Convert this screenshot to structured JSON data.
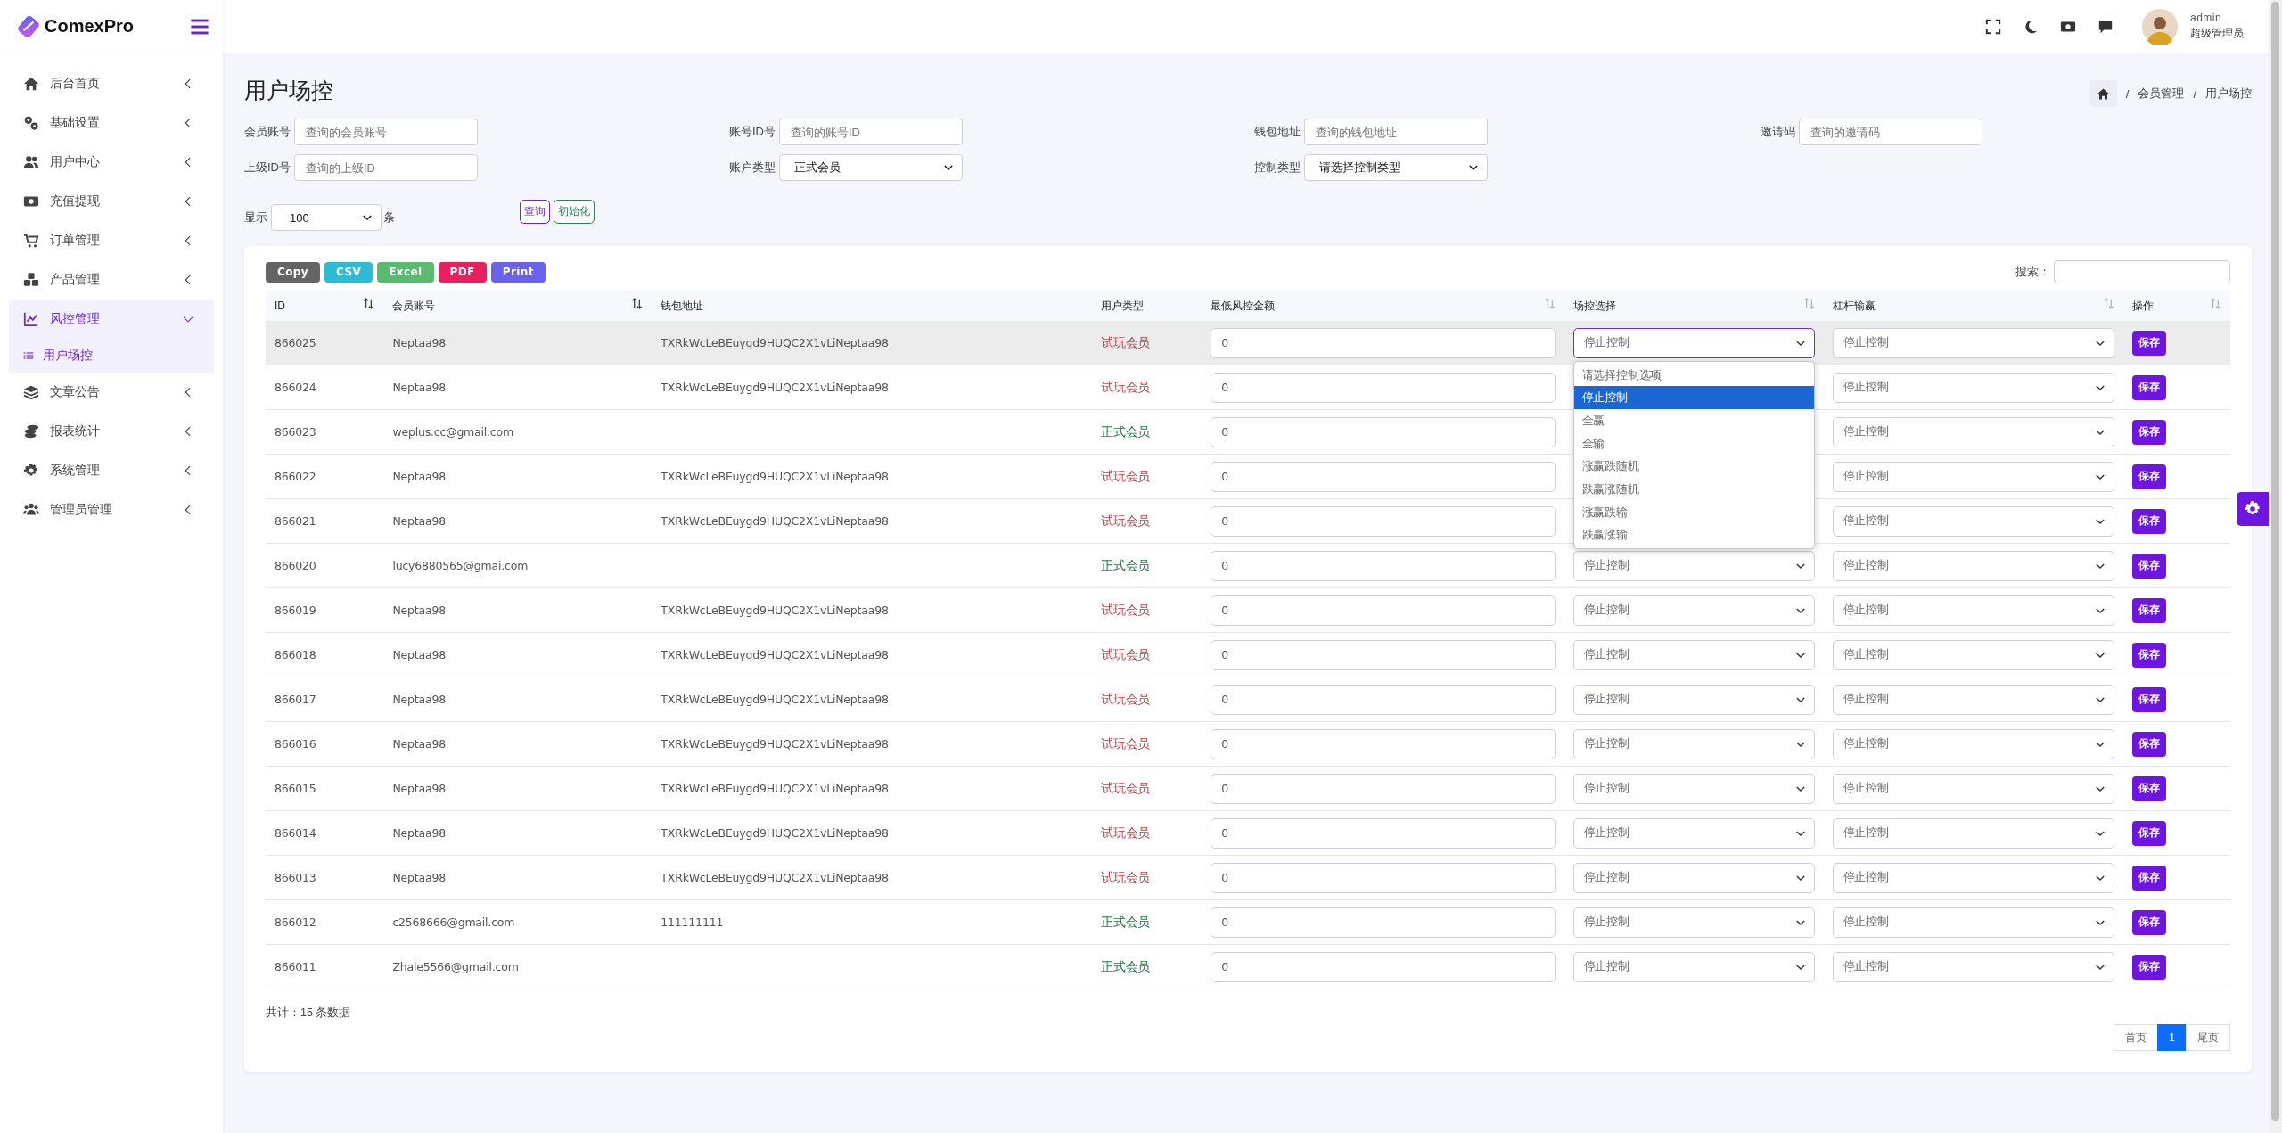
{
  "brand": {
    "name": "ComexPro"
  },
  "sidebar": {
    "items": [
      {
        "label": "后台首页",
        "expanded": false,
        "active": false
      },
      {
        "label": "基础设置",
        "expanded": false,
        "active": false
      },
      {
        "label": "用户中心",
        "expanded": false,
        "active": false
      },
      {
        "label": "充值提现",
        "expanded": false,
        "active": false
      },
      {
        "label": "订单管理",
        "expanded": false,
        "active": false
      },
      {
        "label": "产品管理",
        "expanded": false,
        "active": false
      },
      {
        "label": "风控管理",
        "expanded": true,
        "active": true,
        "children": [
          {
            "label": "用户场控",
            "selected": true
          }
        ]
      },
      {
        "label": "文章公告",
        "expanded": false,
        "active": false
      },
      {
        "label": "报表统计",
        "expanded": false,
        "active": false
      },
      {
        "label": "系统管理",
        "expanded": false,
        "active": false
      },
      {
        "label": "管理员管理",
        "expanded": false,
        "active": false
      }
    ]
  },
  "header": {
    "user": {
      "name": "admin",
      "role": "超级管理员"
    }
  },
  "page": {
    "title": "用户场控",
    "breadcrumb": [
      {
        "separator": "/",
        "label": "会员管理"
      },
      {
        "separator": "/",
        "label": "用户场控"
      }
    ]
  },
  "filters": [
    {
      "kind": "text",
      "label": "会员账号",
      "placeholder": "查询的会员账号"
    },
    {
      "kind": "text",
      "label": "账号ID号",
      "placeholder": "查询的账号ID"
    },
    {
      "kind": "text",
      "label": "钱包地址",
      "placeholder": "查询的钱包地址"
    },
    {
      "kind": "text",
      "label": "邀请码",
      "placeholder": "查询的邀请码"
    },
    {
      "kind": "text",
      "label": "上级ID号",
      "placeholder": "查询的上级ID"
    },
    {
      "kind": "select",
      "label": "账户类型",
      "value": "正式会员"
    },
    {
      "kind": "select",
      "label": "控制类型",
      "value": "请选择控制类型"
    }
  ],
  "page_size": {
    "label": "显示",
    "value": "100",
    "unit": "条"
  },
  "actions": [
    {
      "kind": "query",
      "label": "查询"
    },
    {
      "kind": "reset",
      "label": "初始化"
    }
  ],
  "export_buttons": [
    {
      "label": "Copy",
      "color": "#656565"
    },
    {
      "label": "CSV",
      "color": "#2bbbd3"
    },
    {
      "label": "Excel",
      "color": "#58bb6e"
    },
    {
      "label": "PDF",
      "color": "#e8205f"
    },
    {
      "label": "Print",
      "color": "#6a62ea"
    }
  ],
  "search": {
    "label": "搜索："
  },
  "table": {
    "columns": [
      {
        "label": "ID",
        "sortable": true,
        "sort_active": true
      },
      {
        "label": "会员账号",
        "sortable": true,
        "sort_active": true
      },
      {
        "label": "钱包地址",
        "sortable": false
      },
      {
        "label": "用户类型",
        "sortable": false
      },
      {
        "label": "最低风控金额",
        "sortable": true,
        "sort_active": false
      },
      {
        "label": "场控选择",
        "sortable": true,
        "sort_active": false
      },
      {
        "label": "杠杆输赢",
        "sortable": true,
        "sort_active": false
      },
      {
        "label": "操作",
        "sortable": true,
        "sort_active": false
      }
    ],
    "rows": [
      {
        "id": "866025",
        "account": "Neptaa98",
        "wallet": "TXRkWcLeBEuygd9HUQC2X1vLiNeptaa98",
        "user_type": {
          "text": "试玩会员",
          "color": "#b2474a"
        },
        "min_amount": "0",
        "scene": "停止控制",
        "scene_focused": true,
        "scene_menu": [
          {
            "label": "请选择控制选项",
            "selected": false
          },
          {
            "label": "停止控制",
            "selected": true
          },
          {
            "label": "全赢",
            "selected": false
          },
          {
            "label": "全输",
            "selected": false
          },
          {
            "label": "涨赢跌随机",
            "selected": false
          },
          {
            "label": "跌赢涨随机",
            "selected": false
          },
          {
            "label": "涨赢跌输",
            "selected": false
          },
          {
            "label": "跌赢涨输",
            "selected": false
          }
        ],
        "leverage": "停止控制",
        "action": "保存",
        "highlighted": true
      },
      {
        "id": "866024",
        "account": "Neptaa98",
        "wallet": "TXRkWcLeBEuygd9HUQC2X1vLiNeptaa98",
        "user_type": {
          "text": "试玩会员",
          "color": "#b2474a"
        },
        "min_amount": "0",
        "leverage": "停止控制",
        "action": "保存",
        "highlighted": false
      },
      {
        "id": "866023",
        "account": "weplus.cc@gmail.com",
        "user_type": {
          "text": "正式会员",
          "color": "#1f7a42"
        },
        "min_amount": "0",
        "leverage": "停止控制",
        "action": "保存",
        "highlighted": false
      },
      {
        "id": "866022",
        "account": "Neptaa98",
        "wallet": "TXRkWcLeBEuygd9HUQC2X1vLiNeptaa98",
        "user_type": {
          "text": "试玩会员",
          "color": "#b2474a"
        },
        "min_amount": "0",
        "leverage": "停止控制",
        "action": "保存",
        "highlighted": false
      },
      {
        "id": "866021",
        "account": "Neptaa98",
        "wallet": "TXRkWcLeBEuygd9HUQC2X1vLiNeptaa98",
        "user_type": {
          "text": "试玩会员",
          "color": "#b2474a"
        },
        "min_amount": "0",
        "leverage": "停止控制",
        "action": "保存",
        "highlighted": false
      },
      {
        "id": "866020",
        "account": "lucy6880565@gmai.com",
        "user_type": {
          "text": "正式会员",
          "color": "#1f7a42"
        },
        "min_amount": "0",
        "scene": "停止控制",
        "scene_focused": false,
        "leverage": "停止控制",
        "action": "保存",
        "highlighted": false
      },
      {
        "id": "866019",
        "account": "Neptaa98",
        "wallet": "TXRkWcLeBEuygd9HUQC2X1vLiNeptaa98",
        "user_type": {
          "text": "试玩会员",
          "color": "#b2474a"
        },
        "min_amount": "0",
        "scene": "停止控制",
        "scene_focused": false,
        "leverage": "停止控制",
        "action": "保存",
        "highlighted": false
      },
      {
        "id": "866018",
        "account": "Neptaa98",
        "wallet": "TXRkWcLeBEuygd9HUQC2X1vLiNeptaa98",
        "user_type": {
          "text": "试玩会员",
          "color": "#b2474a"
        },
        "min_amount": "0",
        "scene": "停止控制",
        "scene_focused": false,
        "leverage": "停止控制",
        "action": "保存",
        "highlighted": false
      },
      {
        "id": "866017",
        "account": "Neptaa98",
        "wallet": "TXRkWcLeBEuygd9HUQC2X1vLiNeptaa98",
        "user_type": {
          "text": "试玩会员",
          "color": "#b2474a"
        },
        "min_amount": "0",
        "scene": "停止控制",
        "scene_focused": false,
        "leverage": "停止控制",
        "action": "保存",
        "highlighted": false
      },
      {
        "id": "866016",
        "account": "Neptaa98",
        "wallet": "TXRkWcLeBEuygd9HUQC2X1vLiNeptaa98",
        "user_type": {
          "text": "试玩会员",
          "color": "#b2474a"
        },
        "min_amount": "0",
        "scene": "停止控制",
        "scene_focused": false,
        "leverage": "停止控制",
        "action": "保存",
        "highlighted": false
      },
      {
        "id": "866015",
        "account": "Neptaa98",
        "wallet": "TXRkWcLeBEuygd9HUQC2X1vLiNeptaa98",
        "user_type": {
          "text": "试玩会员",
          "color": "#b2474a"
        },
        "min_amount": "0",
        "scene": "停止控制",
        "scene_focused": false,
        "leverage": "停止控制",
        "action": "保存",
        "highlighted": false
      },
      {
        "id": "866014",
        "account": "Neptaa98",
        "wallet": "TXRkWcLeBEuygd9HUQC2X1vLiNeptaa98",
        "user_type": {
          "text": "试玩会员",
          "color": "#b2474a"
        },
        "min_amount": "0",
        "scene": "停止控制",
        "scene_focused": false,
        "leverage": "停止控制",
        "action": "保存",
        "highlighted": false
      },
      {
        "id": "866013",
        "account": "Neptaa98",
        "wallet": "TXRkWcLeBEuygd9HUQC2X1vLiNeptaa98",
        "user_type": {
          "text": "试玩会员",
          "color": "#b2474a"
        },
        "min_amount": "0",
        "scene": "停止控制",
        "scene_focused": false,
        "leverage": "停止控制",
        "action": "保存",
        "highlighted": false
      },
      {
        "id": "866012",
        "account": "c2568666@gmail.com",
        "wallet": "111111111",
        "user_type": {
          "text": "正式会员",
          "color": "#1f7a42"
        },
        "min_amount": "0",
        "scene": "停止控制",
        "scene_focused": false,
        "leverage": "停止控制",
        "action": "保存",
        "highlighted": false
      },
      {
        "id": "866011",
        "account": "Zhale5566@gmail.com",
        "user_type": {
          "text": "正式会员",
          "color": "#1f7a42"
        },
        "min_amount": "0",
        "scene": "停止控制",
        "scene_focused": false,
        "leverage": "停止控制",
        "action": "保存",
        "highlighted": false
      }
    ]
  },
  "total": "共计：15 条数据",
  "pagination": [
    {
      "label": "首页",
      "selected": false
    },
    {
      "label": "1",
      "selected": true
    },
    {
      "label": "尾页",
      "selected": false
    }
  ]
}
